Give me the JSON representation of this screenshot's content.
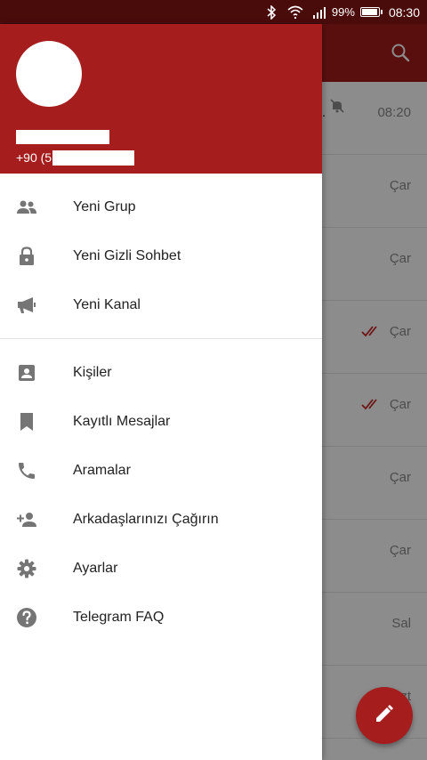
{
  "status_bar": {
    "battery_percent_text": "99%",
    "battery_level": 0.99,
    "time": "08:30"
  },
  "colors": {
    "brand_red": "#a51d1d",
    "status_dark_red": "#4a0b0b",
    "icon_gray": "#757575",
    "text_dark": "#222222",
    "tick_red": "#c62828"
  },
  "background_list": {
    "rows": [
      {
        "time": "08:20",
        "muted": true,
        "ticks": false
      },
      {
        "time": "Çar",
        "muted": false,
        "ticks": false
      },
      {
        "time": "Çar",
        "muted": false,
        "ticks": false
      },
      {
        "time": "Çar",
        "muted": false,
        "ticks": true
      },
      {
        "time": "Çar",
        "muted": false,
        "ticks": true
      },
      {
        "time": "Çar",
        "muted": false,
        "ticks": false
      },
      {
        "time": "Çar",
        "muted": false,
        "ticks": false
      },
      {
        "time": "Sal",
        "muted": false,
        "ticks": false
      },
      {
        "time": "Pzt",
        "muted": false,
        "ticks": false
      }
    ]
  },
  "drawer": {
    "phone_prefix": "+90 (5",
    "menu_groups": [
      [
        {
          "label": "Yeni Grup",
          "icon": "group-icon"
        },
        {
          "label": "Yeni Gizli Sohbet",
          "icon": "lock-icon"
        },
        {
          "label": "Yeni Kanal",
          "icon": "megaphone-icon"
        }
      ],
      [
        {
          "label": "Kişiler",
          "icon": "contact-icon"
        },
        {
          "label": "Kayıtlı Mesajlar",
          "icon": "bookmark-icon"
        },
        {
          "label": "Aramalar",
          "icon": "phone-icon"
        },
        {
          "label": "Arkadaşlarınızı Çağırın",
          "icon": "add-person-icon"
        },
        {
          "label": "Ayarlar",
          "icon": "settings-icon"
        },
        {
          "label": "Telegram FAQ",
          "icon": "help-icon"
        }
      ]
    ]
  }
}
